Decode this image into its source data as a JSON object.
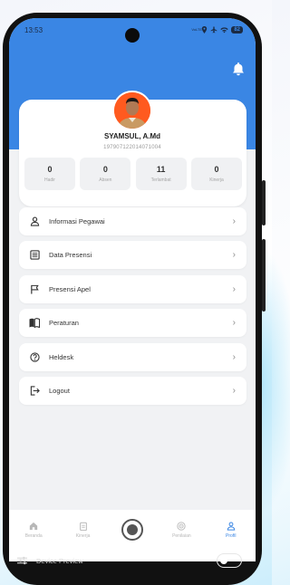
{
  "status_bar": {
    "time": "13:53",
    "signal_text": "VoLTE",
    "battery": "82"
  },
  "profile": {
    "name": "SYAMSUL, A.Md",
    "nip": "197907122014071004"
  },
  "stats": [
    {
      "value": "0",
      "label": "Hadir"
    },
    {
      "value": "0",
      "label": "Absen"
    },
    {
      "value": "11",
      "label": "Terlambat"
    },
    {
      "value": "0",
      "label": "Kinerja"
    }
  ],
  "menu": [
    {
      "label": "Informasi Pegawai",
      "icon": "person-icon"
    },
    {
      "label": "Data Presensi",
      "icon": "list-document-icon"
    },
    {
      "label": "Presensi Apel",
      "icon": "flag-icon"
    },
    {
      "label": "Peraturan",
      "icon": "book-icon"
    },
    {
      "label": "Heldesk",
      "icon": "help-circle-icon"
    },
    {
      "label": "Logout",
      "icon": "logout-icon"
    }
  ],
  "bottom_nav": [
    {
      "label": "Beranda",
      "icon": "home-icon"
    },
    {
      "label": "Kinerja",
      "icon": "clipboard-icon"
    },
    {
      "label": "",
      "icon": "record-button-icon"
    },
    {
      "label": "Penilaian",
      "icon": "target-icon"
    },
    {
      "label": "Profil",
      "icon": "profile-icon"
    }
  ],
  "device_preview": {
    "label": "Device Preview"
  },
  "colors": {
    "primary": "#3a86e4",
    "background": "#f1f2f4",
    "card": "#ffffff",
    "avatar_bg": "#ff5a1f"
  }
}
